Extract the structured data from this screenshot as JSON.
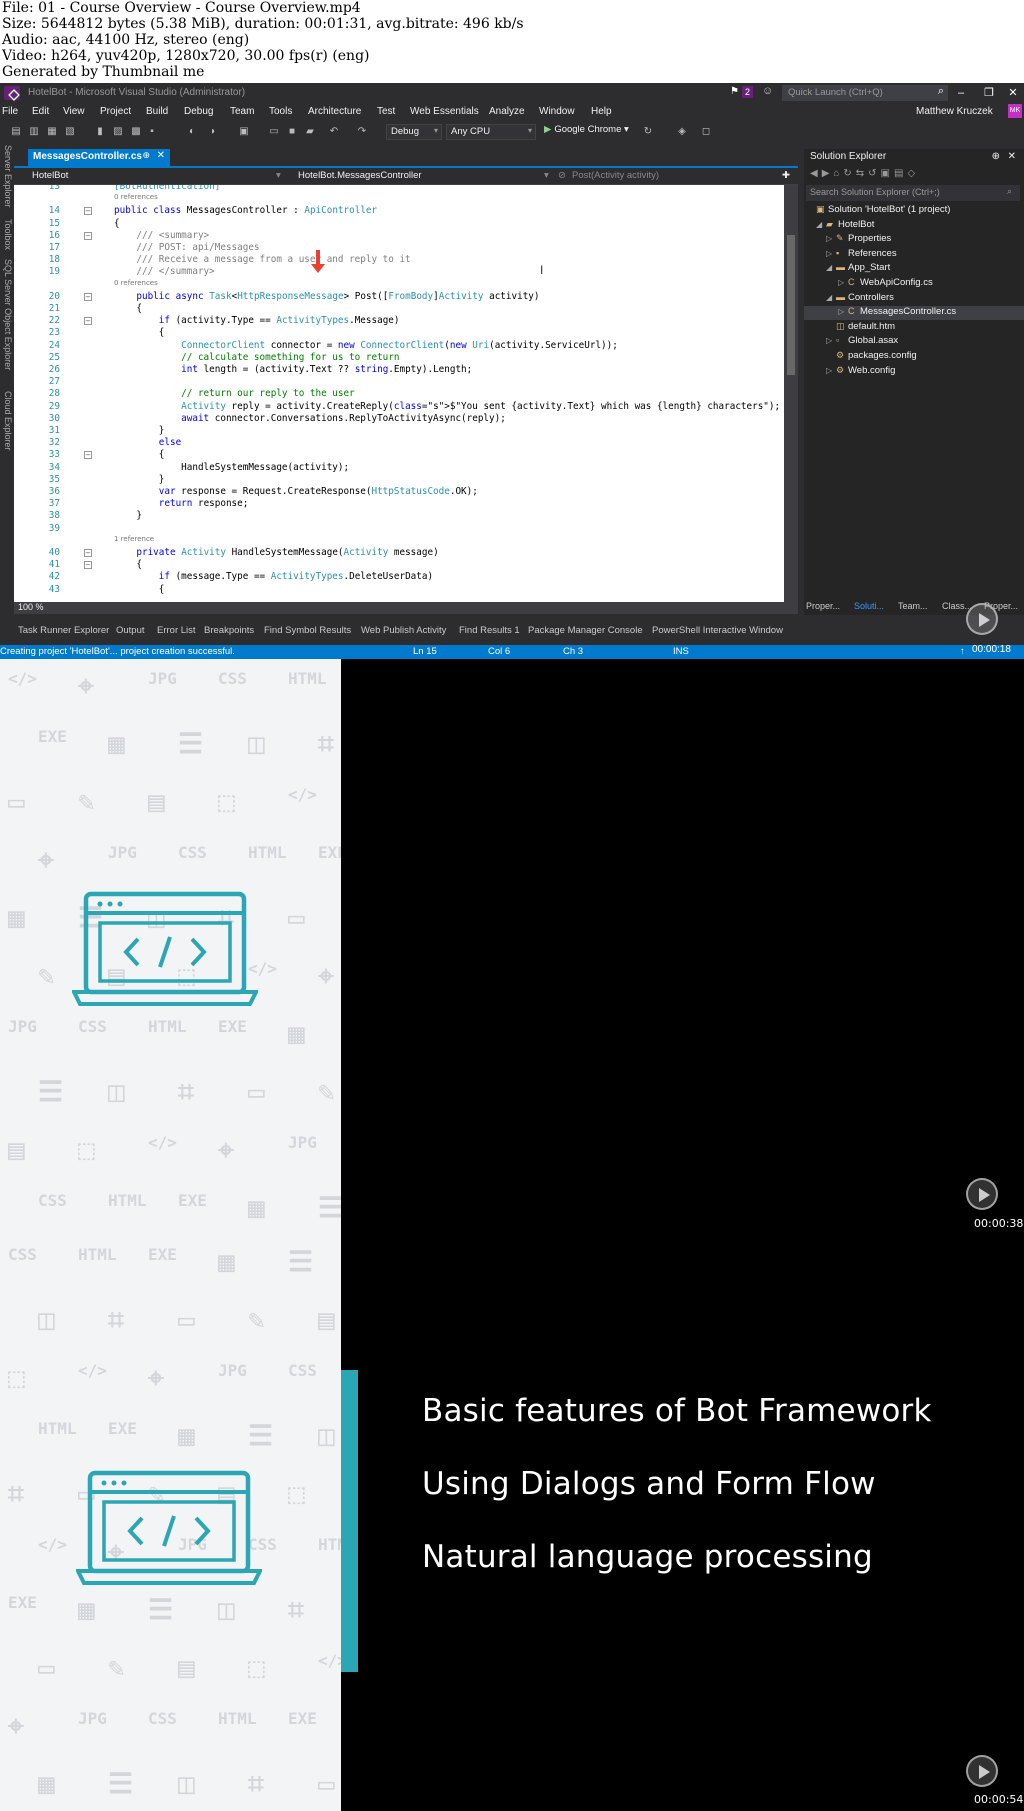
{
  "meta": {
    "file": "File: 01 - Course Overview - Course Overview.mp4",
    "size": "Size: 5644812 bytes (5.38 MiB), duration: 00:01:31, avg.bitrate: 496 kb/s",
    "audio": "Audio: aac, 44100 Hz, stereo (eng)",
    "video": "Video: h264, yuv420p, 1280x720, 30.00 fps(r) (eng)",
    "generated": "Generated by Thumbnail me"
  },
  "vs": {
    "title": "HotelBot - Microsoft Visual Studio (Administrator)",
    "notifications": "2",
    "quick_launch": "Quick Launch (Ctrl+Q)",
    "menu": [
      "File",
      "Edit",
      "View",
      "Project",
      "Build",
      "Debug",
      "Team",
      "Tools",
      "Architecture",
      "Test",
      "Web Essentials",
      "Analyze",
      "Window",
      "Help"
    ],
    "user": "Matthew Kruczek",
    "avatar": "MK",
    "config": "Debug",
    "platform": "Any CPU",
    "browser": "Google Chrome",
    "doc_tab": "MessagesController.cs",
    "nav": [
      "HotelBot",
      "HotelBot.MessagesController",
      "Post(Activity activity)"
    ],
    "side_tools": [
      "Server Explorer",
      "Toolbox",
      "SQL Server Object Explorer",
      "Cloud Explorer"
    ],
    "zoom": "100 %",
    "solution_explorer": {
      "title": "Solution Explorer",
      "search": "Search Solution Explorer (Ctrl+;)",
      "tree": [
        {
          "label": "Solution 'HotelBot' (1 project)",
          "icon": "solution-icon"
        },
        {
          "label": "HotelBot",
          "icon": "project-icon"
        },
        {
          "label": "Properties",
          "icon": "wrench-icon"
        },
        {
          "label": "References",
          "icon": "references-icon"
        },
        {
          "label": "App_Start",
          "icon": "folder-icon"
        },
        {
          "label": "WebApiConfig.cs",
          "icon": "csharp-icon"
        },
        {
          "label": "Controllers",
          "icon": "folder-icon"
        },
        {
          "label": "MessagesController.cs",
          "icon": "csharp-icon"
        },
        {
          "label": "default.htm",
          "icon": "html-icon"
        },
        {
          "label": "Global.asax",
          "icon": "file-icon"
        },
        {
          "label": "packages.config",
          "icon": "config-icon"
        },
        {
          "label": "Web.config",
          "icon": "config-icon"
        }
      ],
      "bottom_tabs": [
        "Proper...",
        "Soluti...",
        "Team...",
        "Class...",
        "Proper..."
      ]
    },
    "bottom_tabs": [
      "Task Runner Explorer",
      "Output",
      "Error List",
      "Breakpoints",
      "Find Symbol Results",
      "Web Publish Activity",
      "Find Results 1",
      "Package Manager Console",
      "PowerShell Interactive Window"
    ],
    "status": {
      "message": "Creating project 'HotelBot'... project creation successful.",
      "ln": "Ln 15",
      "col": "Col 6",
      "ch": "Ch 3",
      "mode": "INS"
    },
    "code": [
      {
        "n": "13",
        "ref": false,
        "t": "[BotAuthentication]"
      },
      {
        "n": "",
        "ref": true,
        "t": "0 references"
      },
      {
        "n": "14",
        "ref": false,
        "t": "public class MessagesController : ApiController"
      },
      {
        "n": "15",
        "ref": false,
        "t": "{"
      },
      {
        "n": "16",
        "ref": false,
        "t": "    /// <summary>"
      },
      {
        "n": "17",
        "ref": false,
        "t": "    /// POST: api/Messages"
      },
      {
        "n": "18",
        "ref": false,
        "t": "    /// Receive a message from a user and reply to it"
      },
      {
        "n": "19",
        "ref": false,
        "t": "    /// </summary>"
      },
      {
        "n": "",
        "ref": true,
        "t": "0 references"
      },
      {
        "n": "20",
        "ref": false,
        "t": "    public async Task<HttpResponseMessage> Post([FromBody]Activity activity)"
      },
      {
        "n": "21",
        "ref": false,
        "t": "    {"
      },
      {
        "n": "22",
        "ref": false,
        "t": "        if (activity.Type == ActivityTypes.Message)"
      },
      {
        "n": "23",
        "ref": false,
        "t": "        {"
      },
      {
        "n": "24",
        "ref": false,
        "t": "            ConnectorClient connector = new ConnectorClient(new Uri(activity.ServiceUrl));"
      },
      {
        "n": "25",
        "ref": false,
        "t": "            // calculate something for us to return"
      },
      {
        "n": "26",
        "ref": false,
        "t": "            int length = (activity.Text ?? string.Empty).Length;"
      },
      {
        "n": "27",
        "ref": false,
        "t": ""
      },
      {
        "n": "28",
        "ref": false,
        "t": "            // return our reply to the user"
      },
      {
        "n": "29",
        "ref": false,
        "t": "            Activity reply = activity.CreateReply($\"You sent {activity.Text} which was {length} characters\");"
      },
      {
        "n": "30",
        "ref": false,
        "t": "            await connector.Conversations.ReplyToActivityAsync(reply);"
      },
      {
        "n": "31",
        "ref": false,
        "t": "        }"
      },
      {
        "n": "32",
        "ref": false,
        "t": "        else"
      },
      {
        "n": "33",
        "ref": false,
        "t": "        {"
      },
      {
        "n": "34",
        "ref": false,
        "t": "            HandleSystemMessage(activity);"
      },
      {
        "n": "35",
        "ref": false,
        "t": "        }"
      },
      {
        "n": "36",
        "ref": false,
        "t": "        var response = Request.CreateResponse(HttpStatusCode.OK);"
      },
      {
        "n": "37",
        "ref": false,
        "t": "        return response;"
      },
      {
        "n": "38",
        "ref": false,
        "t": "    }"
      },
      {
        "n": "39",
        "ref": false,
        "t": ""
      },
      {
        "n": "",
        "ref": true,
        "t": "1 reference"
      },
      {
        "n": "40",
        "ref": false,
        "t": "    private Activity HandleSystemMessage(Activity message)"
      },
      {
        "n": "41",
        "ref": false,
        "t": "    {"
      },
      {
        "n": "42",
        "ref": false,
        "t": "        if (message.Type == ActivityTypes.DeleteUserData)"
      },
      {
        "n": "43",
        "ref": false,
        "t": "        {"
      }
    ]
  },
  "timestamps": [
    "00:00:18",
    "00:00:38",
    "00:00:54"
  ],
  "slide_bullets": [
    "Basic features of Bot Framework",
    "Using Dialogs and Form Flow",
    "Natural language processing"
  ],
  "colors": {
    "vs_bg": "#2d2d30",
    "vs_accent": "#007acc",
    "slide_accent": "#2aa6b5",
    "pattern_bg": "#f3f4f6"
  }
}
